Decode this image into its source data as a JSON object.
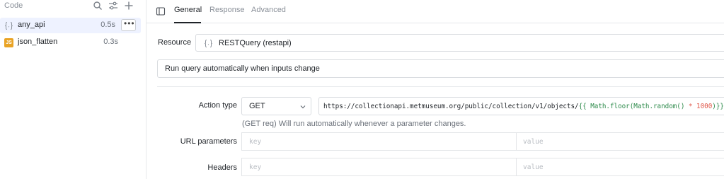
{
  "sidebar": {
    "title": "Code",
    "icons": [
      "search-icon",
      "filter-icon",
      "plus-icon"
    ],
    "queries": [
      {
        "name": "any_api",
        "time": "0.5s",
        "icon": "rest-braces-icon",
        "selected": true
      },
      {
        "name": "json_flatten",
        "time": "0.3s",
        "icon": "js-badge-icon",
        "badge": "JS",
        "selected": false
      }
    ]
  },
  "tabs": {
    "items": [
      {
        "label": "General",
        "active": true
      },
      {
        "label": "Response",
        "active": false
      },
      {
        "label": "Advanced",
        "active": false
      }
    ]
  },
  "resource": {
    "label": "Resource",
    "value": "RESTQuery (restapi)"
  },
  "trigger": {
    "value": "Run query automatically when inputs change"
  },
  "action": {
    "label": "Action type",
    "method": "GET",
    "url_base": "https://collectionapi.metmuseum.org/public/collection/v1/objects/",
    "url_open": "{{ ",
    "url_fn_floor": "Math.floor(",
    "url_fn_random": "Math.random() ",
    "url_op": "* ",
    "url_num": "1000",
    "url_close_paren": ")",
    "url_close": "}}",
    "hint": "(GET req) Will run automatically whenever a parameter changes."
  },
  "url_params": {
    "label": "URL parameters",
    "key_placeholder": "key",
    "value_placeholder": "value"
  },
  "headers": {
    "label": "Headers",
    "key_placeholder": "key",
    "value_placeholder": "value"
  },
  "colors": {
    "selected_bg": "#eef2ff",
    "js_badge": "#e9a325",
    "template_green": "#2c8a4a",
    "template_red": "#e0584a"
  }
}
